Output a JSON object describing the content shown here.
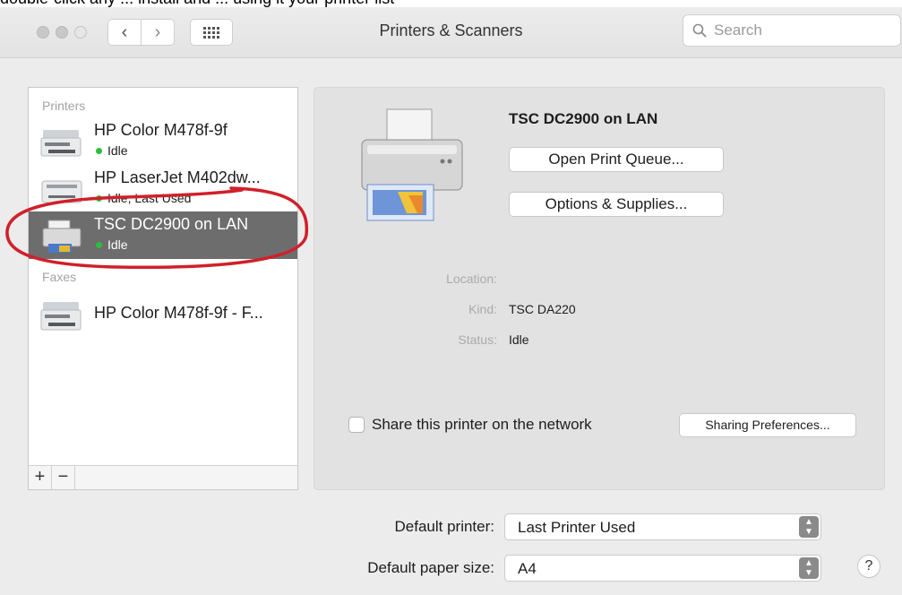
{
  "doc_strip": {
    "text": "double-click any ... install and ... using it your printer list"
  },
  "window": {
    "title": "Printers & Scanners",
    "nav": {
      "back_icon": "‹",
      "forward_icon": "›"
    }
  },
  "search": {
    "placeholder": "Search"
  },
  "printers_section_label": "Printers",
  "faxes_section_label": "Faxes",
  "printers": [
    {
      "name": "HP Color M478f-9f",
      "status": "Idle"
    },
    {
      "name": "HP LaserJet M402dw...",
      "status": "Idle, Last Used"
    },
    {
      "name": "TSC DC2900 on LAN",
      "status": "Idle"
    }
  ],
  "faxes": [
    {
      "name": "HP Color M478f-9f - F..."
    }
  ],
  "list_footer": {
    "add": "+",
    "remove": "−"
  },
  "detail": {
    "name": "TSC DC2900 on LAN",
    "open_queue": "Open Print Queue...",
    "options_supplies": "Options & Supplies...",
    "location_label": "Location:",
    "location_value": "",
    "kind_label": "Kind:",
    "kind_value": "TSC DA220",
    "status_label": "Status:",
    "status_value": "Idle",
    "share_label": "Share this printer on the network",
    "share_checked": false,
    "sharing_prefs": "Sharing Preferences..."
  },
  "defaults": {
    "printer_label": "Default printer:",
    "printer_value": "Last Printer Used",
    "paper_label": "Default paper size:",
    "paper_value": "A4"
  },
  "help": "?",
  "colors": {
    "selected_row": "#6d6d6d",
    "status_dot": "#2bbf3a",
    "annotation": "#d0202a"
  }
}
